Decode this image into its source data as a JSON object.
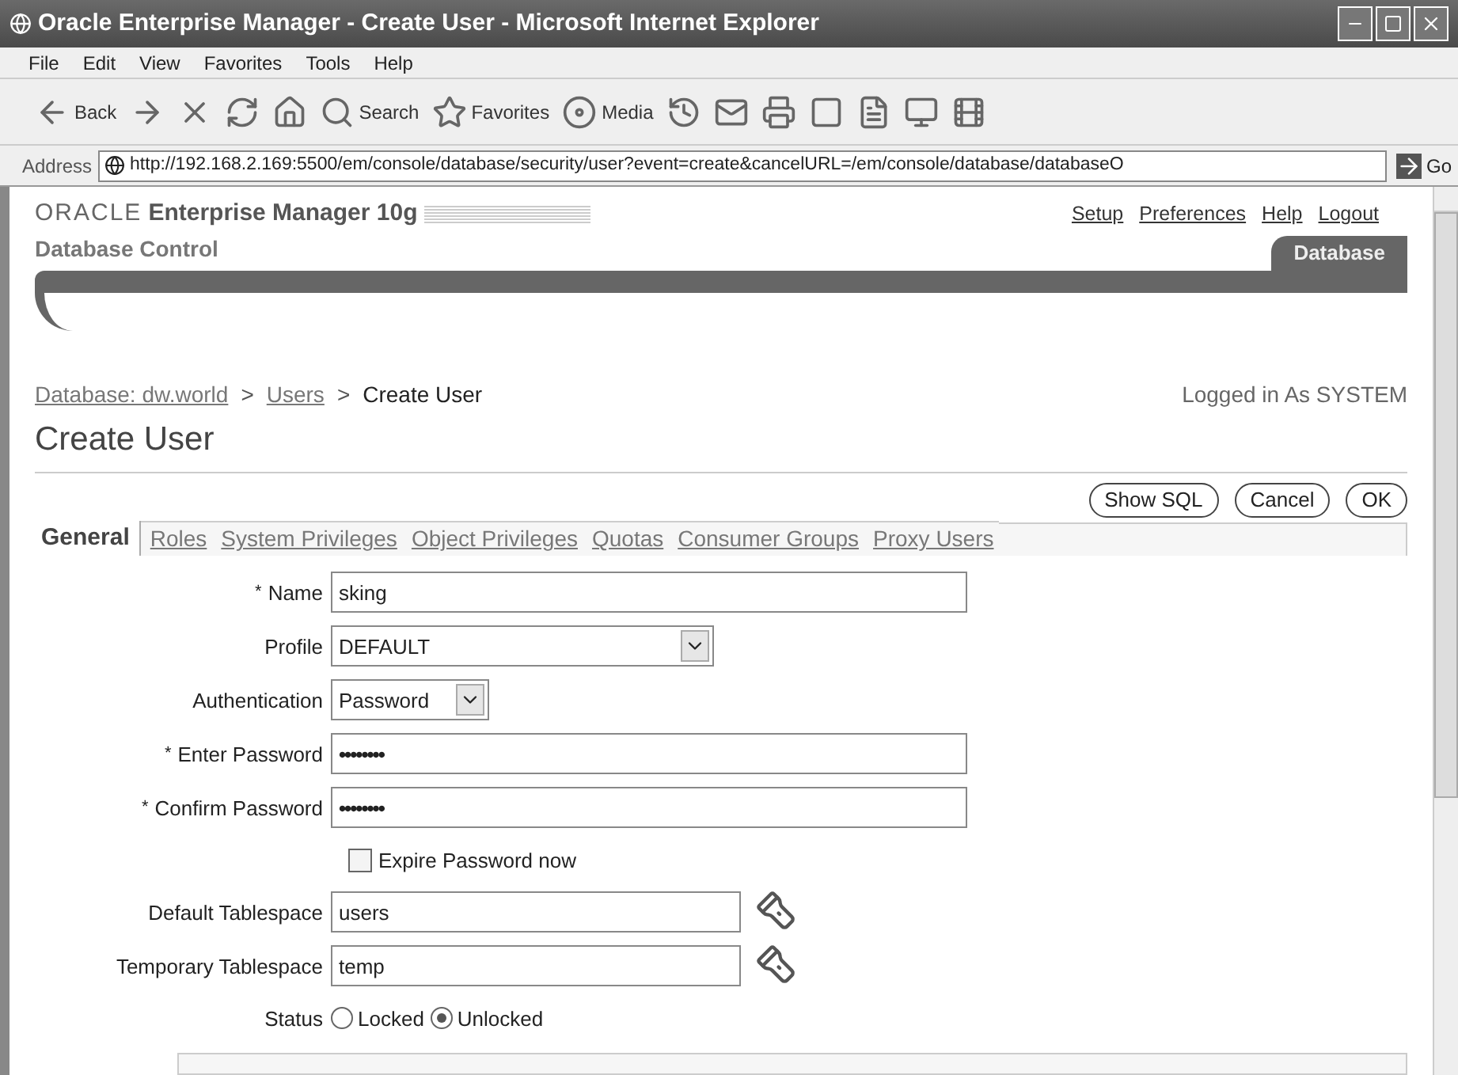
{
  "window": {
    "title": "Oracle Enterprise Manager - Create User - Microsoft Internet Explorer"
  },
  "menu": [
    "File",
    "Edit",
    "View",
    "Favorites",
    "Tools",
    "Help"
  ],
  "toolbar": [
    {
      "kind": "back",
      "label": "Back"
    },
    {
      "kind": "forward"
    },
    {
      "kind": "stop"
    },
    {
      "kind": "refresh"
    },
    {
      "kind": "home"
    },
    {
      "kind": "search",
      "label": "Search"
    },
    {
      "kind": "favorites",
      "label": "Favorites"
    },
    {
      "kind": "media",
      "label": "Media"
    },
    {
      "kind": "history"
    },
    {
      "kind": "mail"
    },
    {
      "kind": "print"
    },
    {
      "kind": "edit"
    },
    {
      "kind": "discuss"
    },
    {
      "kind": "messenger"
    },
    {
      "kind": "research"
    }
  ],
  "address": {
    "label": "Address",
    "url": "http://192.168.2.169:5500/em/console/database/security/user?event=create&cancelURL=/em/console/database/databaseO",
    "go": "Go"
  },
  "header": {
    "brand": "ORACLE",
    "product": "Enterprise Manager 10g",
    "subtitle": "Database Control",
    "links": [
      "Setup",
      "Preferences",
      "Help",
      "Logout"
    ],
    "tab": "Database"
  },
  "breadcrumb": [
    {
      "label": "Database: dw.world",
      "link": true
    },
    {
      "label": "Users",
      "link": true
    },
    {
      "label": "Create User",
      "link": false
    }
  ],
  "breadcrumb_separator": ">",
  "logged_in": "Logged in As SYSTEM",
  "page_title": "Create User",
  "buttons": [
    "Show SQL",
    "Cancel",
    "OK"
  ],
  "tabs": [
    {
      "label": "General",
      "selected": true
    },
    {
      "label": "Roles",
      "selected": false
    },
    {
      "label": "System Privileges",
      "selected": false
    },
    {
      "label": "Object Privileges",
      "selected": false
    },
    {
      "label": "Quotas",
      "selected": false
    },
    {
      "label": "Consumer Groups",
      "selected": false
    },
    {
      "label": "Proxy Users",
      "selected": false
    }
  ],
  "form": [
    {
      "kind": "text",
      "label": "Name",
      "required": true,
      "value": "sking"
    },
    {
      "kind": "select",
      "label": "Profile",
      "required": false,
      "value": "DEFAULT"
    },
    {
      "kind": "select",
      "label": "Authentication",
      "required": false,
      "value": "Password"
    },
    {
      "kind": "password",
      "label": "Enter Password",
      "required": true,
      "value": "••••••••"
    },
    {
      "kind": "password",
      "label": "Confirm Password",
      "required": true,
      "value": "••••••••"
    },
    {
      "kind": "checkbox",
      "label": "Expire Password now",
      "checked": false
    },
    {
      "kind": "lookup",
      "label": "Default Tablespace",
      "required": false,
      "value": "users"
    },
    {
      "kind": "lookup",
      "label": "Temporary Tablespace",
      "required": false,
      "value": "temp"
    },
    {
      "kind": "radio",
      "label": "Status",
      "options": [
        {
          "label": "Locked",
          "selected": false
        },
        {
          "label": "Unlocked",
          "selected": true
        }
      ]
    }
  ],
  "required_mark": "*"
}
